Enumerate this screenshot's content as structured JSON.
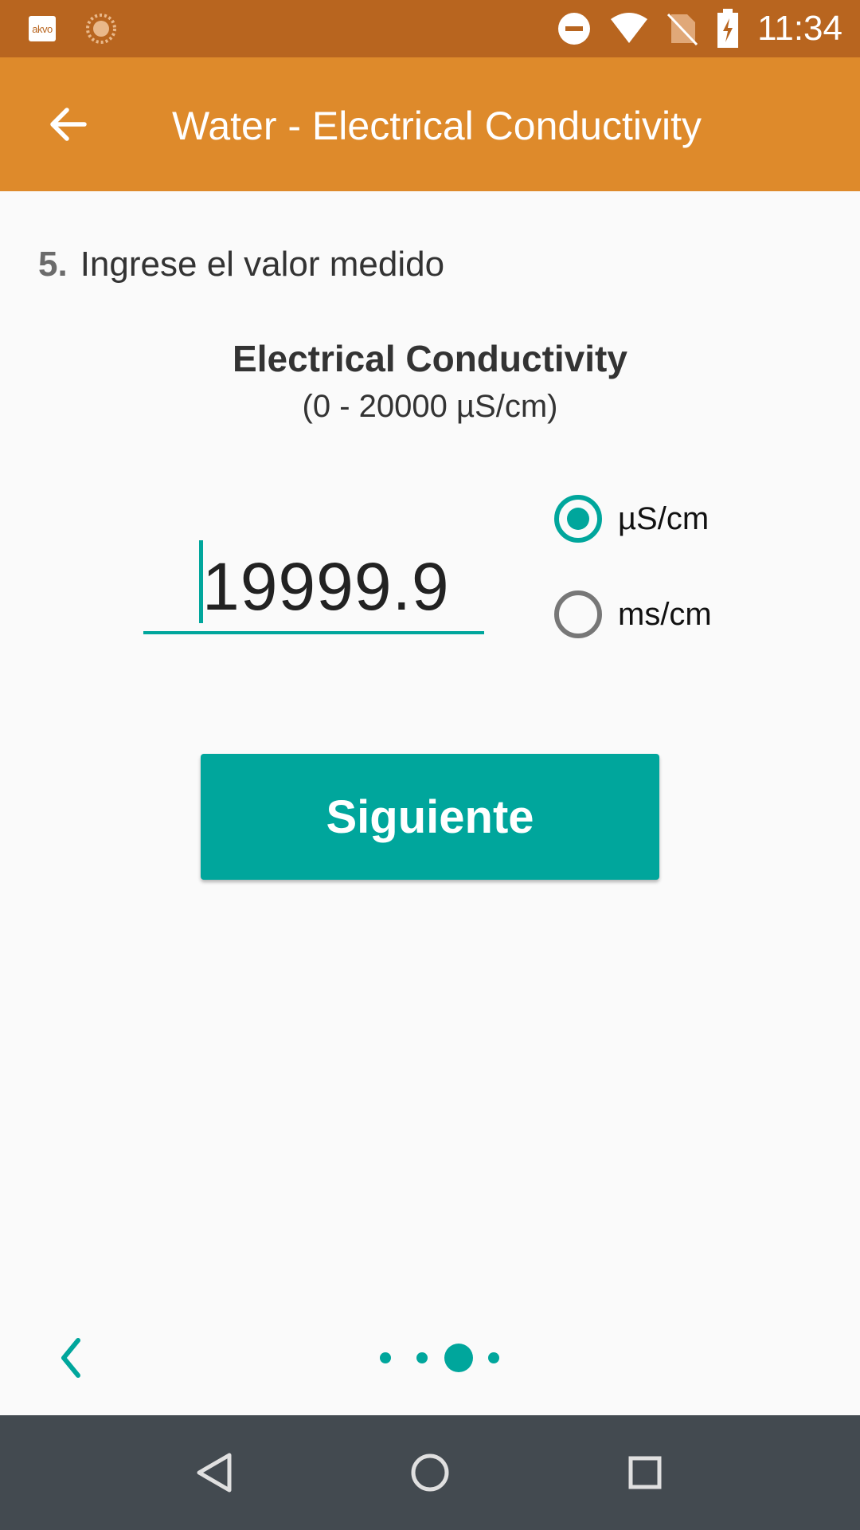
{
  "status_bar": {
    "time": "11:34",
    "left_icons": [
      "akvo-icon",
      "sun-icon"
    ],
    "akvo_badge": "akvo",
    "right_icons": [
      "do-not-disturb-icon",
      "wifi-icon",
      "no-sim-icon",
      "battery-charging-icon"
    ]
  },
  "app_bar": {
    "title": "Water - Electrical Conductivity",
    "back_icon": "arrow-left-icon"
  },
  "question": {
    "number": "5.",
    "text": "Ingrese el valor medido"
  },
  "parameter": {
    "name": "Electrical Conductivity",
    "range": "(0 - 20000 µS/cm)"
  },
  "input": {
    "value": "19999.9"
  },
  "units": [
    {
      "label": "µS/cm",
      "selected": true
    },
    {
      "label": "ms/cm",
      "selected": false
    }
  ],
  "next_button": {
    "label": "Siguiente"
  },
  "pager": {
    "page_count": 4,
    "current_page": 3
  },
  "nav_bar": {
    "buttons": [
      "back-triangle-icon",
      "home-circle-icon",
      "recents-square-icon"
    ]
  },
  "colors": {
    "status_bar": "#b8651f",
    "app_bar": "#de8a2b",
    "accent": "#00a69c",
    "nav_bar": "#434a50",
    "background": "#fafafa"
  }
}
